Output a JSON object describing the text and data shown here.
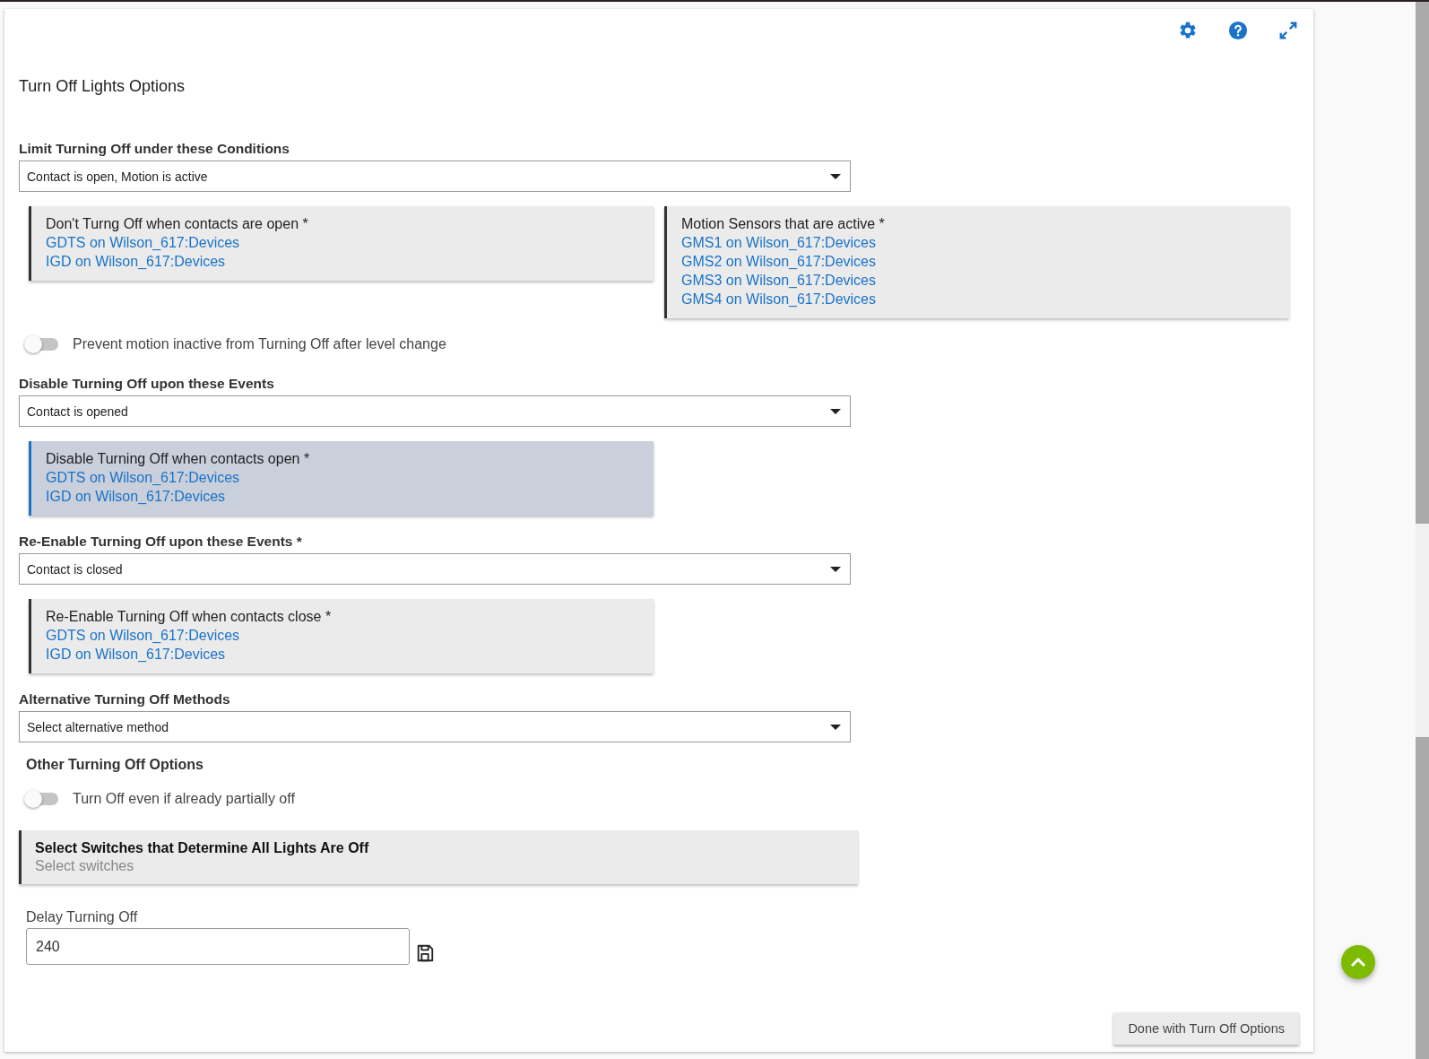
{
  "title": "Turn Off Lights Options",
  "sections": [
    {
      "kind": "select",
      "label": "Limit Turning Off under these Conditions",
      "value": "Contact is open, Motion is active"
    },
    {
      "kind": "boxes",
      "boxes": [
        {
          "title": "Don't Turng Off when contacts are open *",
          "highlighted": false,
          "links": [
            "GDTS on Wilson_617:Devices",
            "IGD on Wilson_617:Devices"
          ]
        },
        {
          "title": "Motion Sensors that are active *",
          "highlighted": false,
          "links": [
            "GMS1 on Wilson_617:Devices",
            "GMS2 on Wilson_617:Devices",
            "GMS3 on Wilson_617:Devices",
            "GMS4 on Wilson_617:Devices"
          ]
        }
      ]
    },
    {
      "kind": "toggle",
      "label": "Prevent motion inactive from Turning Off after level change",
      "on": false
    },
    {
      "kind": "select",
      "label": "Disable Turning Off upon these Events",
      "value": "Contact is opened"
    },
    {
      "kind": "boxes",
      "boxes": [
        {
          "title": "Disable Turning Off when contacts open *",
          "highlighted": true,
          "links": [
            "GDTS on Wilson_617:Devices",
            "IGD on Wilson_617:Devices"
          ]
        }
      ]
    },
    {
      "kind": "select",
      "label": "Re-Enable Turning Off upon these Events *",
      "value": "Contact is closed"
    },
    {
      "kind": "boxes",
      "boxes": [
        {
          "title": "Re-Enable Turning Off when contacts close *",
          "highlighted": false,
          "links": [
            "GDTS on Wilson_617:Devices",
            "IGD on Wilson_617:Devices"
          ]
        }
      ]
    },
    {
      "kind": "select",
      "label": "Alternative Turning Off Methods",
      "value": "Select alternative method"
    },
    {
      "kind": "subheading",
      "label": "Other Turning Off Options"
    },
    {
      "kind": "toggle",
      "label": "Turn Off even if already partially off",
      "on": false
    },
    {
      "kind": "picker",
      "title": "Select Switches that Determine All Lights Are Off",
      "placeholder": "Select switches"
    },
    {
      "kind": "number",
      "label": "Delay Turning Off",
      "value": "240"
    }
  ],
  "done_button": "Done with Turn Off Options"
}
